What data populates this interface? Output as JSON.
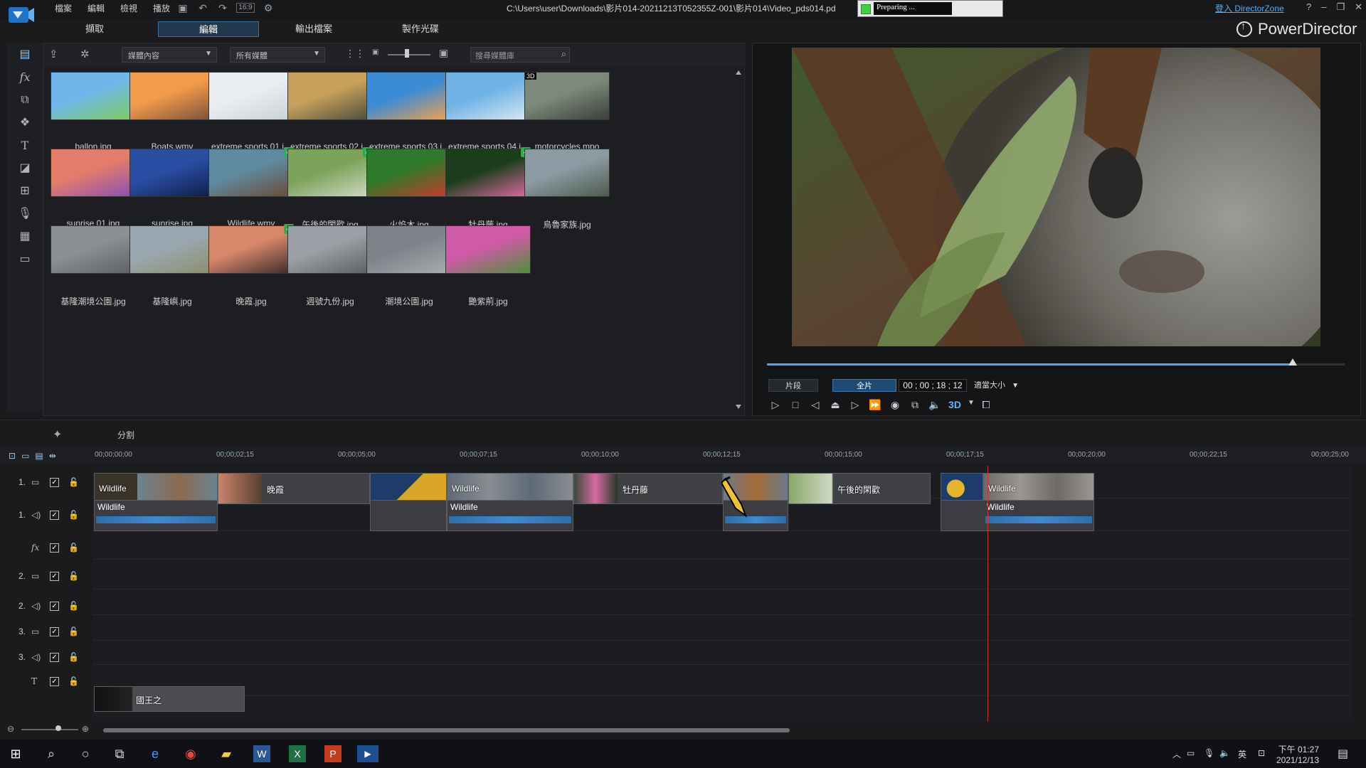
{
  "titlebar": {
    "menu": [
      "檔案",
      "編輯",
      "檢視",
      "播放"
    ],
    "path": "C:\\Users\\user\\Downloads\\影片014-20211213T052355Z-001\\影片014\\Video_pds014.pd",
    "status_text": "Preparing ...",
    "signin": "登入 DirectorZone",
    "ratio_label": "16:9"
  },
  "modules": [
    {
      "label": "擷取"
    },
    {
      "label": "編輯"
    },
    {
      "label": "輸出檔案"
    },
    {
      "label": "製作光碟"
    }
  ],
  "brand": "PowerDirector",
  "library": {
    "filter_media": "媒體內容",
    "filter_tags": "所有媒體",
    "search_placeholder": "搜尋媒體庫",
    "items": [
      {
        "name": "ballon.jpg",
        "colors": [
          "#6fb7ea",
          "#7fce5a"
        ]
      },
      {
        "name": "Boats.wmv",
        "colors": [
          "#f19b4b",
          "#7b4e3a"
        ]
      },
      {
        "name": "extreme sports 01.j...",
        "colors": [
          "#e9eef2",
          "#c9d1d6"
        ]
      },
      {
        "name": "extreme sports 02.j...",
        "colors": [
          "#c7a15a",
          "#4b4b3d"
        ]
      },
      {
        "name": "extreme sports 03.j...",
        "colors": [
          "#3b8bd6",
          "#f3a14a"
        ]
      },
      {
        "name": "extreme sports 04.j...",
        "colors": [
          "#6fb2e6",
          "#d9e8f3"
        ]
      },
      {
        "name": "motorcycles.mpo",
        "colors": [
          "#7d8a7a",
          "#3a3f3a"
        ]
      },
      {
        "name": "sunrise 01.jpg",
        "colors": [
          "#e37d6a",
          "#8a4eb3"
        ]
      },
      {
        "name": "sunrise.jpg",
        "colors": [
          "#2a4ea3",
          "#0f1d45"
        ]
      },
      {
        "name": "Wildlife.wmv",
        "colors": [
          "#5f8aa0",
          "#6b4a35"
        ]
      },
      {
        "name": "午後的閑歡.jpg",
        "colors": [
          "#7ca35a",
          "#d0d9c4"
        ]
      },
      {
        "name": "火焰木.jpg",
        "colors": [
          "#2f7a2a",
          "#c83a2a"
        ]
      },
      {
        "name": "牡丹藤.jpg",
        "colors": [
          "#1b3d1b",
          "#e06aa3"
        ]
      },
      {
        "name": "烏魯家族.jpg",
        "colors": [
          "#8c9aa3",
          "#4d5b4d"
        ]
      },
      {
        "name": "基隆潮境公園.jpg",
        "colors": [
          "#8b9094",
          "#5d6063"
        ]
      },
      {
        "name": "基隆嶼.jpg",
        "colors": [
          "#9aa7b0",
          "#8b8f6a"
        ]
      },
      {
        "name": "晚霞.jpg",
        "colors": [
          "#d8876a",
          "#3a2a2a"
        ]
      },
      {
        "name": "週號九份.jpg",
        "colors": [
          "#9aa0a5",
          "#5a5f63"
        ]
      },
      {
        "name": "潮境公園.jpg",
        "colors": [
          "#7d8389",
          "#a8adb1"
        ]
      },
      {
        "name": "艷紫荊.jpg",
        "colors": [
          "#d05aa8",
          "#4f8f3a"
        ]
      }
    ]
  },
  "preview": {
    "mode_clip": "片段",
    "mode_movie": "全片",
    "timecode": "00 ; 00 ; 18 ; 12",
    "zoom": "適當大小",
    "progress": 0.91
  },
  "timeline": {
    "split_label": "分割",
    "ruler": [
      "00;00;00;00",
      "00;00;02;15",
      "00;00;05;00",
      "00;00;07;15",
      "00;00;10;00",
      "00;00;12;15",
      "00;00;15;00",
      "00;00;17;15",
      "00;00;20;00",
      "00;00;22;15",
      "00;00;25;00"
    ],
    "tracks": [
      {
        "num": "1.",
        "type": "video"
      },
      {
        "num": "1.",
        "type": "audio"
      },
      {
        "num": "",
        "type": "fx"
      },
      {
        "num": "2.",
        "type": "video"
      },
      {
        "num": "2.",
        "type": "audio"
      },
      {
        "num": "3.",
        "type": "video"
      },
      {
        "num": "3.",
        "type": "audio"
      },
      {
        "num": "",
        "type": "title"
      }
    ],
    "video_clips": [
      "Wildlife",
      "晚霞",
      "",
      "Wildlife",
      "牡丹藤",
      "",
      "午後的閑歡",
      "",
      "Wildlife"
    ],
    "audio_clips": [
      "Wildlife",
      "Wildlife",
      "Wildlife"
    ],
    "title_clip": "國王之"
  },
  "taskbar": {
    "time": "下午 01:27",
    "date": "2021/12/13",
    "ime": "英"
  }
}
